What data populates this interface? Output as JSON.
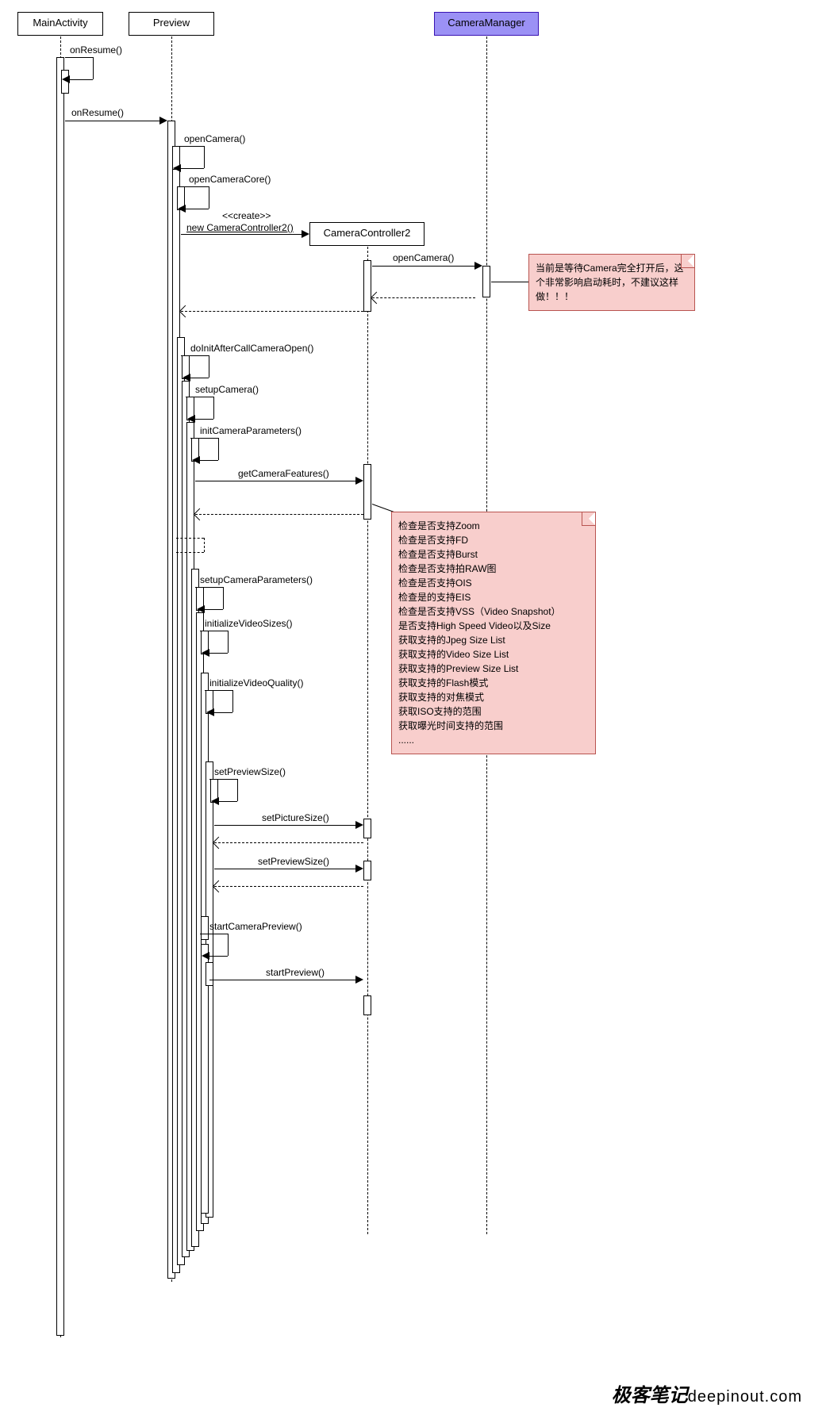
{
  "participants": {
    "mainActivity": "MainActivity",
    "preview": "Preview",
    "cameraManager": "CameraManager",
    "cameraController2": "CameraController2"
  },
  "messages": {
    "onResume1": "onResume()",
    "onResume2": "onResume()",
    "openCamera": "openCamera()",
    "openCameraCore": "openCameraCore()",
    "create": "<<create>>",
    "newController": "new CameraController2()",
    "openCamera2": "openCamera()",
    "doInitAfterCallCameraOpen": "doInitAfterCallCameraOpen()",
    "setupCamera": "setupCamera()",
    "initCameraParameters": "initCameraParameters()",
    "getCameraFeatures": "getCameraFeatures()",
    "setupCameraParameters": "setupCameraParameters()",
    "initializeVideoSizes": "initializeVideoSizes()",
    "initializeVideoQuality": "initializeVideoQuality()",
    "setPreviewSize": "setPreviewSize()",
    "setPictureSize": "setPictureSize()",
    "setPreviewSize2": "setPreviewSize()",
    "startCameraPreview": "startCameraPreview()",
    "startPreview": "startPreview()"
  },
  "notes": {
    "note1": "当前是等待Camera完全打开后，这个非常影响启动耗时，不建议这样做！！！",
    "note2_lines": [
      "检查是否支持Zoom",
      "检查是否支持FD",
      "检查是否支持Burst",
      "检查是否支持拍RAW图",
      "检查是否支持OIS",
      "检查是的支持EIS",
      "检查是否支持VSS（Video Snapshot）",
      "是否支持High Speed Video以及Size",
      "获取支持的Jpeg Size List",
      "获取支持的Video Size List",
      "获取支持的Preview Size List",
      "获取支持的Flash模式",
      "获取支持的对焦模式",
      "获取ISO支持的范围",
      "获取曝光时间支持的范围",
      "......"
    ]
  },
  "footer": {
    "brand": "极客笔记",
    "url": "deepinout.com"
  }
}
